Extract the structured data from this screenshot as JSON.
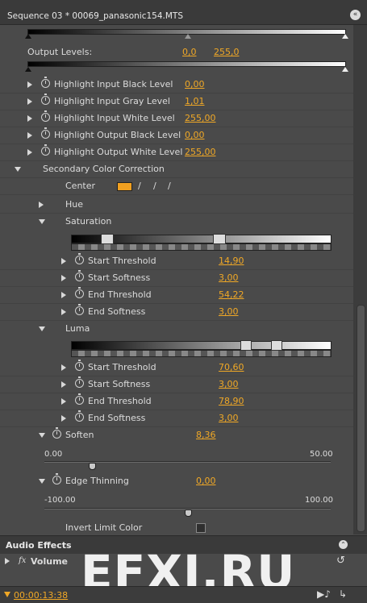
{
  "header": {
    "title": "Sequence 03 * 00069_panasonic154.MTS"
  },
  "output_levels": {
    "label": "Output Levels:",
    "low": "0,0",
    "high": "255,0"
  },
  "params": [
    {
      "label": "Highlight Input Black Level",
      "value": "0,00"
    },
    {
      "label": "Highlight Input Gray Level",
      "value": "1,01"
    },
    {
      "label": "Highlight Input White Level",
      "value": "255,00"
    },
    {
      "label": "Highlight Output Black Level",
      "value": "0,00"
    },
    {
      "label": "Highlight Output White Level",
      "value": "255,00"
    }
  ],
  "secondary": {
    "label": "Secondary Color Correction",
    "center_label": "Center",
    "center_color": "#f0a020",
    "hue_label": "Hue",
    "saturation_label": "Saturation",
    "saturation_items": [
      {
        "label": "Start Threshold",
        "value": "14,90"
      },
      {
        "label": "Start Softness",
        "value": "3,00"
      },
      {
        "label": "End Threshold",
        "value": "54,22"
      },
      {
        "label": "End Softness",
        "value": "3,00"
      }
    ],
    "luma_label": "Luma",
    "luma_items": [
      {
        "label": "Start Threshold",
        "value": "70,60"
      },
      {
        "label": "Start Softness",
        "value": "3,00"
      },
      {
        "label": "End Threshold",
        "value": "78,90"
      },
      {
        "label": "End Softness",
        "value": "3,00"
      }
    ],
    "soften": {
      "label": "Soften",
      "value": "8,36",
      "min": "0.00",
      "max": "50.00",
      "fraction": 0.167
    },
    "edge_thinning": {
      "label": "Edge Thinning",
      "value": "0,00",
      "min": "-100.00",
      "max": "100.00",
      "fraction": 0.5
    },
    "invert_label": "Invert Limit Color",
    "invert_checked": false
  },
  "audio": {
    "title": "Audio Effects",
    "fx_label": "fx",
    "volume_label": "Volume"
  },
  "footer": {
    "timecode": "00:00:13:38"
  },
  "watermark": "EFXI.RU"
}
